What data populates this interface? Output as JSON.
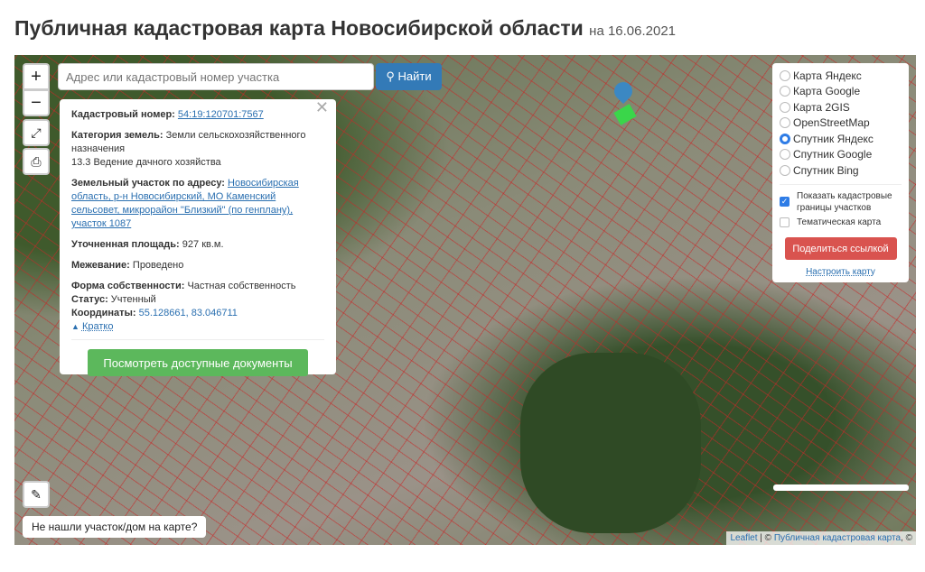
{
  "title": "Публичная кадастровая карта Новосибирской области",
  "date": "на 16.06.2021",
  "search": {
    "placeholder": "Адрес или кадастровый номер участка",
    "button": "Найти"
  },
  "zoom": {
    "in": "+",
    "out": "−"
  },
  "popup": {
    "cadnum_label": "Кадастровый номер:",
    "cadnum": "54:19:120701:7567",
    "category_label": "Категория земель:",
    "category": "Земли сельскохозяйственного назначения",
    "use": "13.3 Ведение дачного хозяйства",
    "address_label": "Земельный участок по адресу:",
    "address": "Новосибирская область, р-н Новосибирский, МО Каменский сельсовет, микрорайон \"Близкий\" (по генплану), участок 1087",
    "area_label": "Уточненная площадь:",
    "area": "927 кв.м.",
    "survey_label": "Межевание:",
    "survey": "Проведено",
    "ownership_label": "Форма собственности:",
    "ownership": "Частная собственность",
    "status_label": "Статус:",
    "status": "Учтенный",
    "coords_label": "Координаты:",
    "coords": "55.128661, 83.046711",
    "collapse": "Кратко",
    "docs_button": "Посмотреть доступные документы"
  },
  "layers": {
    "options": [
      "Карта Яндекс",
      "Карта Google",
      "Карта 2GIS",
      "OpenStreetMap",
      "Спутник Яндекс",
      "Спутник Google",
      "Спутник Bing"
    ],
    "selected": "Спутник Яндекс",
    "show_borders": "Показать кадастровые границы участков",
    "thematic": "Тематическая карта",
    "share": "Поделиться ссылкой",
    "configure": "Настроить карту"
  },
  "not_found": "Не нашли участок/дом на карте?",
  "attribution": {
    "leaflet": "Leaflet",
    "sep": " | © ",
    "pkk": "Публичная кадастровая карта",
    "tail": ", ©"
  }
}
